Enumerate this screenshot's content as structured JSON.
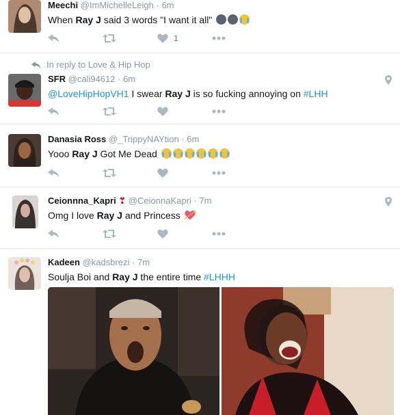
{
  "tweets": [
    {
      "name": "Meechi",
      "handle": "@ImMichelleLeigh",
      "time": "6m",
      "text_pre": "When ",
      "text_bold": "Ray J",
      "text_post": " said 3 words \"I want it all\"",
      "likes": "1",
      "emoji": [
        "dark-face",
        "dark-face",
        "crying-laughing"
      ]
    },
    {
      "reply_context": "In reply to Love & Hip Hop",
      "name": "SFR",
      "handle": "@cali94612",
      "time": "6m",
      "mention": "@LoveHipHopVH1",
      "text_pre": " I swear ",
      "text_bold": "Ray J",
      "text_post": " is so fucking annoying on ",
      "hashtag": "#LHH",
      "geo": true
    },
    {
      "name": "Danasia Ross",
      "handle": "@_TrippyNAYtion",
      "time": "6m",
      "text_pre": "Yooo ",
      "text_bold": "Ray J",
      "text_post": " Got Me Dead",
      "emoji": [
        "loudly-crying",
        "loudly-crying",
        "loudly-crying",
        "loudly-crying",
        "loudly-crying",
        "loudly-crying"
      ]
    },
    {
      "name": "Ceionnna_Kapri",
      "name_emoji": "heart-exclamation",
      "handle": "@CeionnaKapri",
      "time": "7m",
      "text_pre": "Omg I love ",
      "text_bold": "Ray J",
      "text_post": " and Princess",
      "emoji": [
        "cupid-heart"
      ],
      "geo": true
    },
    {
      "name": "Kadeen",
      "handle": "@kadsbrezi",
      "time": "7m",
      "text_pre": "Soulja Boi and ",
      "text_bold": "Ray J",
      "text_post": " the entire time ",
      "hashtag": "#LHHH"
    }
  ],
  "separator": "·",
  "colors": {
    "link": "#1b95e0",
    "meta": "#8899a6",
    "action": "#aab8c2",
    "border": "#e1e8ed"
  },
  "icons": {
    "reply": "reply-icon",
    "retweet": "retweet-icon",
    "like": "heart-icon",
    "more": "more-icon",
    "geo": "location-pin-icon"
  }
}
